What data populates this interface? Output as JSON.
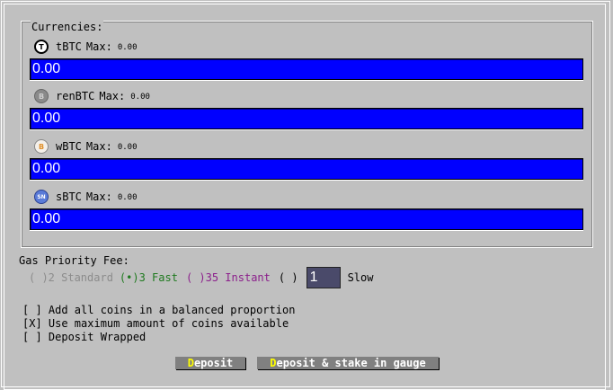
{
  "currencies": {
    "legend": "Currencies:",
    "max_label": "Max:",
    "coins": [
      {
        "name": "tBTC",
        "max": "0.00",
        "amount": "0.00",
        "icon": "tbtc-coin-icon",
        "glyph": "T"
      },
      {
        "name": "renBTC",
        "max": "0.00",
        "amount": "0.00",
        "icon": "renbtc-coin-icon",
        "glyph": "B"
      },
      {
        "name": "wBTC",
        "max": "0.00",
        "amount": "0.00",
        "icon": "wbtc-coin-icon",
        "glyph": "B"
      },
      {
        "name": "sBTC",
        "max": "0.00",
        "amount": "0.00",
        "icon": "sbtc-coin-icon",
        "glyph": "SN"
      }
    ]
  },
  "gas": {
    "label": "Gas Priority Fee:",
    "standard": "( )2 Standard",
    "fast": "(•)3 Fast",
    "instant": "( )35 Instant",
    "custom": "( )",
    "custom_value": "1",
    "slow": "Slow"
  },
  "options": {
    "balanced": "[ ] Add all coins in a balanced proportion",
    "maximum": "[X] Use maximum amount of coins available",
    "wrapped": "[ ] Deposit Wrapped"
  },
  "buttons": {
    "deposit_hotkey": "D",
    "deposit_rest": "eposit",
    "stake_hotkey": "D",
    "stake_rest": "eposit & stake in gauge"
  },
  "colors": {
    "background": "#c0c0c0",
    "input_blue": "#0000ff",
    "fast_green": "#1f7a1f",
    "instant_purple": "#8b1f8b",
    "hotkey_yellow": "#ffff00"
  }
}
